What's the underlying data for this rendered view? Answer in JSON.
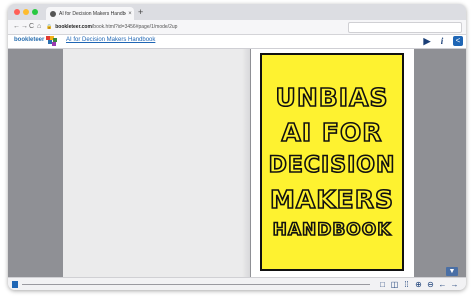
{
  "browser": {
    "tab_title": "AI for Decision Makers Handbo…",
    "tab_close": "×",
    "new_tab": "+",
    "back": "←",
    "forward": "→",
    "reload": "C",
    "home": "⌂",
    "url_domain": "bookleteer.com",
    "url_path": "/book.html?id=3456#page/1/mode/2up"
  },
  "viewer": {
    "logo_text": "bookleteer",
    "title": "AI for Decision Makers Handbook",
    "play": "▶",
    "info": "i",
    "share": "<"
  },
  "cover": {
    "line1": "UNBIAS",
    "line2": "AI FOR",
    "line3": "DECISION",
    "line4": "MAKERS",
    "line5": "HANDBOOK",
    "background_color": "#fef230"
  },
  "controls": {
    "down": "▼",
    "one_page": "□",
    "two_page": "◫",
    "thumbnails": "⁞⁞",
    "zoom_in": "⊕",
    "zoom_out": "⊖",
    "prev": "←",
    "next": "→"
  }
}
